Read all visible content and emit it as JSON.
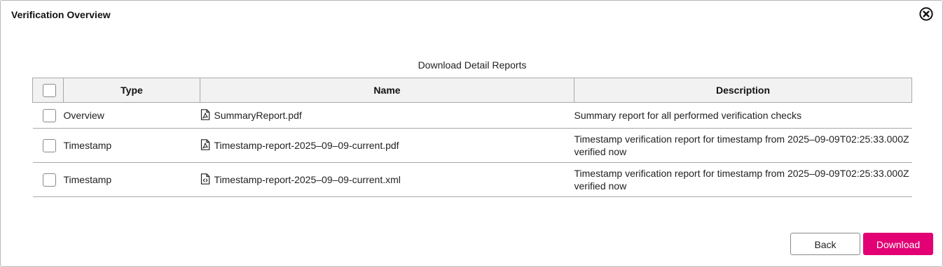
{
  "dialog": {
    "title": "Verification Overview",
    "close_icon": "close-circle-icon"
  },
  "table": {
    "caption": "Download Detail Reports",
    "headers": {
      "type": "Type",
      "name": "Name",
      "description": "Description"
    },
    "rows": [
      {
        "type": "Overview",
        "name": "SummaryReport.pdf",
        "file_icon": "pdf-file-icon",
        "description": "Summary report for all performed verification checks",
        "checked": false
      },
      {
        "type": "Timestamp",
        "name": "Timestamp-report-2025–09–09-current.pdf",
        "file_icon": "pdf-file-icon",
        "description": "Timestamp verification report for timestamp from 2025–09-09T02:25:33.000Z verified now",
        "checked": false
      },
      {
        "type": "Timestamp",
        "name": "Timestamp-report-2025–09–09-current.xml",
        "file_icon": "code-file-icon",
        "description": "Timestamp verification report for timestamp from 2025–09-09T02:25:33.000Z verified now",
        "checked": false
      }
    ]
  },
  "buttons": {
    "back_label": "Back",
    "download_label": "Download"
  },
  "colors": {
    "accent": "#e20074",
    "header_bg": "#f2f2f2",
    "border": "#a8a8a8"
  }
}
